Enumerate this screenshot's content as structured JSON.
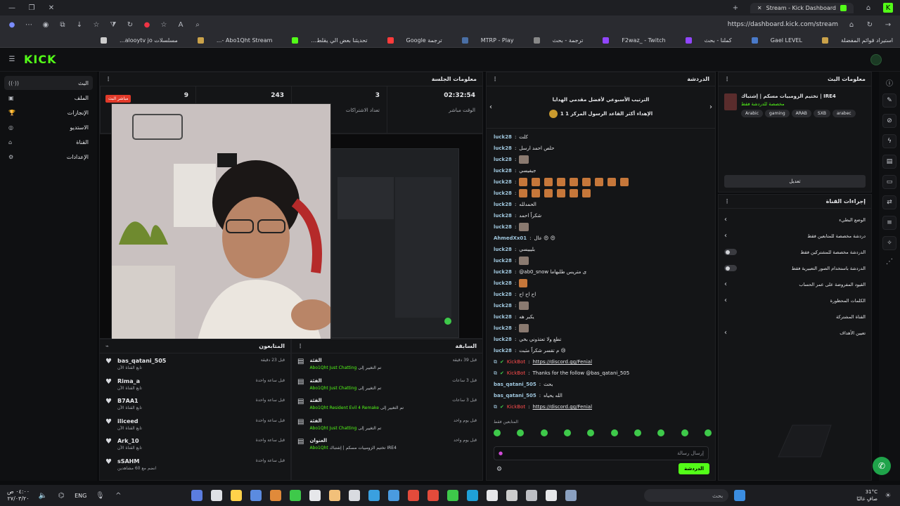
{
  "browser": {
    "tab_title": "Stream - Kick Dashboard",
    "url": "https://dashboard.kick.com/stream",
    "bookmarks": [
      {
        "label": "استيراد قوائم المفضلة",
        "color": "#caa24a"
      },
      {
        "label": "Gael LEVEL",
        "color": "#4a7ac9"
      },
      {
        "label": "كملنا - بحث",
        "color": "#9146ff"
      },
      {
        "label": "F2waz_ - Twitch",
        "color": "#9146ff"
      },
      {
        "label": "ترجمة - بحث",
        "color": "#888888"
      },
      {
        "label": "MTRP - Play",
        "color": "#4a6fa5"
      },
      {
        "label": "ترجمة Google",
        "color": "#ff3b3b"
      },
      {
        "label": "تحديثنا بعض الي يقلط...",
        "color": "#53fc18"
      },
      {
        "label": "Abo1Qht Stream -...",
        "color": "#caa24a"
      },
      {
        "label": "مسلسلات alooytv jo...",
        "color": "#cccccc"
      }
    ]
  },
  "kick": {
    "logo": "KICK",
    "sidebar": [
      {
        "label": "البث",
        "icon": "broadcast-icon",
        "active": true
      },
      {
        "label": "الملف",
        "icon": "file-icon",
        "active": false
      },
      {
        "label": "الإنجازات",
        "icon": "trophy-icon",
        "active": false
      },
      {
        "label": "الاستديو",
        "icon": "studio-icon",
        "active": false
      },
      {
        "label": "القناة",
        "icon": "channel-icon",
        "active": false
      },
      {
        "label": "الإعدادات",
        "icon": "settings-icon",
        "active": false
      }
    ]
  },
  "session": {
    "title": "معلومات الجلسة",
    "live_badge": "مباشر البث",
    "stats": [
      {
        "value": "02:32:54",
        "label": "الوقت مباشر"
      },
      {
        "value": "3",
        "label": "تعداد الاشتراكات"
      },
      {
        "value": "243",
        "label": ""
      },
      {
        "value": "9",
        "label": ""
      }
    ]
  },
  "followers": {
    "title": "المتابعون",
    "rows": [
      {
        "name": "bas_qatani_505",
        "sub": "تابع القناة الآن",
        "time": "قبل 23 دقيقة"
      },
      {
        "name": "Rima_a",
        "sub": "تابع القناة الآن",
        "time": "قبل ساعة واحدة"
      },
      {
        "name": "B7AA1",
        "sub": "تابع القناة الآن",
        "time": "قبل ساعة واحدة"
      },
      {
        "name": "iliceed",
        "sub": "تابع القناة الآن",
        "time": "قبل ساعة واحدة"
      },
      {
        "name": "Ark_10",
        "sub": "تابع القناة الآن",
        "time": "قبل ساعة واحدة"
      },
      {
        "name": "sSAHM",
        "sub": "انضم مع 60 مشاهدين",
        "time": "قبل ساعة واحدة"
      }
    ]
  },
  "activity": {
    "title": "السابقة",
    "rows": [
      {
        "title": "الفئة",
        "desc_prefix": "تم التغيير إلى",
        "desc_value": "Just Chatting",
        "by": "Abo1Qht",
        "time": "قبل 39 دقيقة"
      },
      {
        "title": "الفئة",
        "desc_prefix": "تم التغيير إلى",
        "desc_value": "Just Chatting",
        "by": "Abo1Qht",
        "time": "قبل 3 ساعات"
      },
      {
        "title": "الفئة",
        "desc_prefix": "تم التغيير إلى",
        "desc_value": "Resident Evil 4 Remake",
        "by": "Abo1Qht",
        "time": "قبل 3 ساعات"
      },
      {
        "title": "الفئة",
        "desc_prefix": "تم التغيير إلى",
        "desc_value": "Just Chatting",
        "by": "Abo1Qht",
        "time": "قبل يوم واحد"
      },
      {
        "title": "العنوان",
        "desc_prefix": "تختيم الزومبيات مسكم | إشتباك IRE4",
        "desc_value": "",
        "by": "Abo1Qht",
        "time": "قبل يوم واحد"
      }
    ]
  },
  "chat": {
    "title": "الدردشة",
    "pinned_line1": "الترتيب الأسبوعي لأفضل مقدمي الهدايا",
    "pinned_line2": "1 الإهداء أكثر القاعد الرسول المركز 1",
    "messages": [
      {
        "user": "luck28",
        "text": "كلت",
        "kind": "user"
      },
      {
        "user": "luck28",
        "text": "حلص احمد ارسل",
        "kind": "user"
      },
      {
        "user": "luck28",
        "text": "",
        "kind": "thumb"
      },
      {
        "user": "luck28",
        "text": "جيفيسي",
        "kind": "user"
      },
      {
        "user": "luck28",
        "text": "",
        "kind": "emotes9"
      },
      {
        "user": "luck28",
        "text": "",
        "kind": "emotes6"
      },
      {
        "user": "luck28",
        "text": "الحمدلله",
        "kind": "user"
      },
      {
        "user": "luck28",
        "text": "شكراً احمد",
        "kind": "user"
      },
      {
        "user": "luck28",
        "text": "",
        "kind": "thumb"
      },
      {
        "user": "AhmedXx01",
        "text": "عال 😍 😍",
        "kind": "user"
      },
      {
        "user": "luck28",
        "text": "بليييسي",
        "kind": "user"
      },
      {
        "user": "luck28",
        "text": "",
        "kind": "thumb"
      },
      {
        "user": "luck28",
        "text": "@ab0_snow ى متريس طلبهاما",
        "kind": "user"
      },
      {
        "user": "luck28",
        "text": "",
        "kind": "emote1"
      },
      {
        "user": "luck28",
        "text": "اح اح اح",
        "kind": "user"
      },
      {
        "user": "luck28",
        "text": "",
        "kind": "thumb"
      },
      {
        "user": "luck28",
        "text": "يكبر هه",
        "kind": "user"
      },
      {
        "user": "luck28",
        "text": "",
        "kind": "thumb"
      },
      {
        "user": "luck28",
        "text": "تطع ولا تعتذوني بخي",
        "kind": "user"
      },
      {
        "user": "luck28",
        "text": "م تقسر شكراً مثبت 😢",
        "kind": "user"
      },
      {
        "user": "KickBot",
        "text": "https://discord.gg/Fenial",
        "kind": "bot-link"
      },
      {
        "user": "KickBot",
        "text": "Thanks for the follow @bas_qatani_505",
        "kind": "bot"
      },
      {
        "user": "bas_qatani_505",
        "text": "بحث",
        "kind": "user"
      },
      {
        "user": "bas_qatani_505",
        "text": "الله يحياه",
        "kind": "user"
      },
      {
        "user": "KickBot",
        "text": "https://discord.gg/Fenial",
        "kind": "bot-link"
      }
    ],
    "input_placeholder": "إرسال رسالة",
    "send_label": "الدردشة",
    "emote_label": "المتابعين فقط"
  },
  "streaminfo": {
    "title": "معلومات البث",
    "stream_title": "تختيم الزومبيات مسكم | إشتباك | IRE4",
    "category_link": "مخصصة للدردشة فقط",
    "tags": [
      "Arabic",
      "gaming",
      "ARAB",
      "SXB",
      "arabec"
    ],
    "edit_label": "تعديل"
  },
  "channel_actions": {
    "title": "إجراءات القناة",
    "rows": [
      {
        "label": "الوضع البطيء",
        "type": "chevron"
      },
      {
        "label": "دردشة مخصصة للمتابعين فقط",
        "type": "chevron"
      },
      {
        "label": "الدردشة مخصصة للمشتركين فقط",
        "type": "toggle"
      },
      {
        "label": "الدردشة باستخدام الصور التعبيرية فقط",
        "type": "toggle"
      },
      {
        "label": "القيود المفروضة على عمر الحساب",
        "type": "chevron"
      },
      {
        "label": "الكلمات المحظورة",
        "type": "chevron"
      },
      {
        "label": "القناة المشتركة",
        "type": "none"
      },
      {
        "label": "تعيين الأهداف",
        "type": "chevron"
      }
    ]
  },
  "taskbar": {
    "time": "٠٤:٠٠ ص",
    "date": "٢٧/٠٣/٢٠",
    "lang": "ENG",
    "weather": "31°C",
    "weather_desc": "صافٍ غالبًا",
    "search": "بحث"
  }
}
